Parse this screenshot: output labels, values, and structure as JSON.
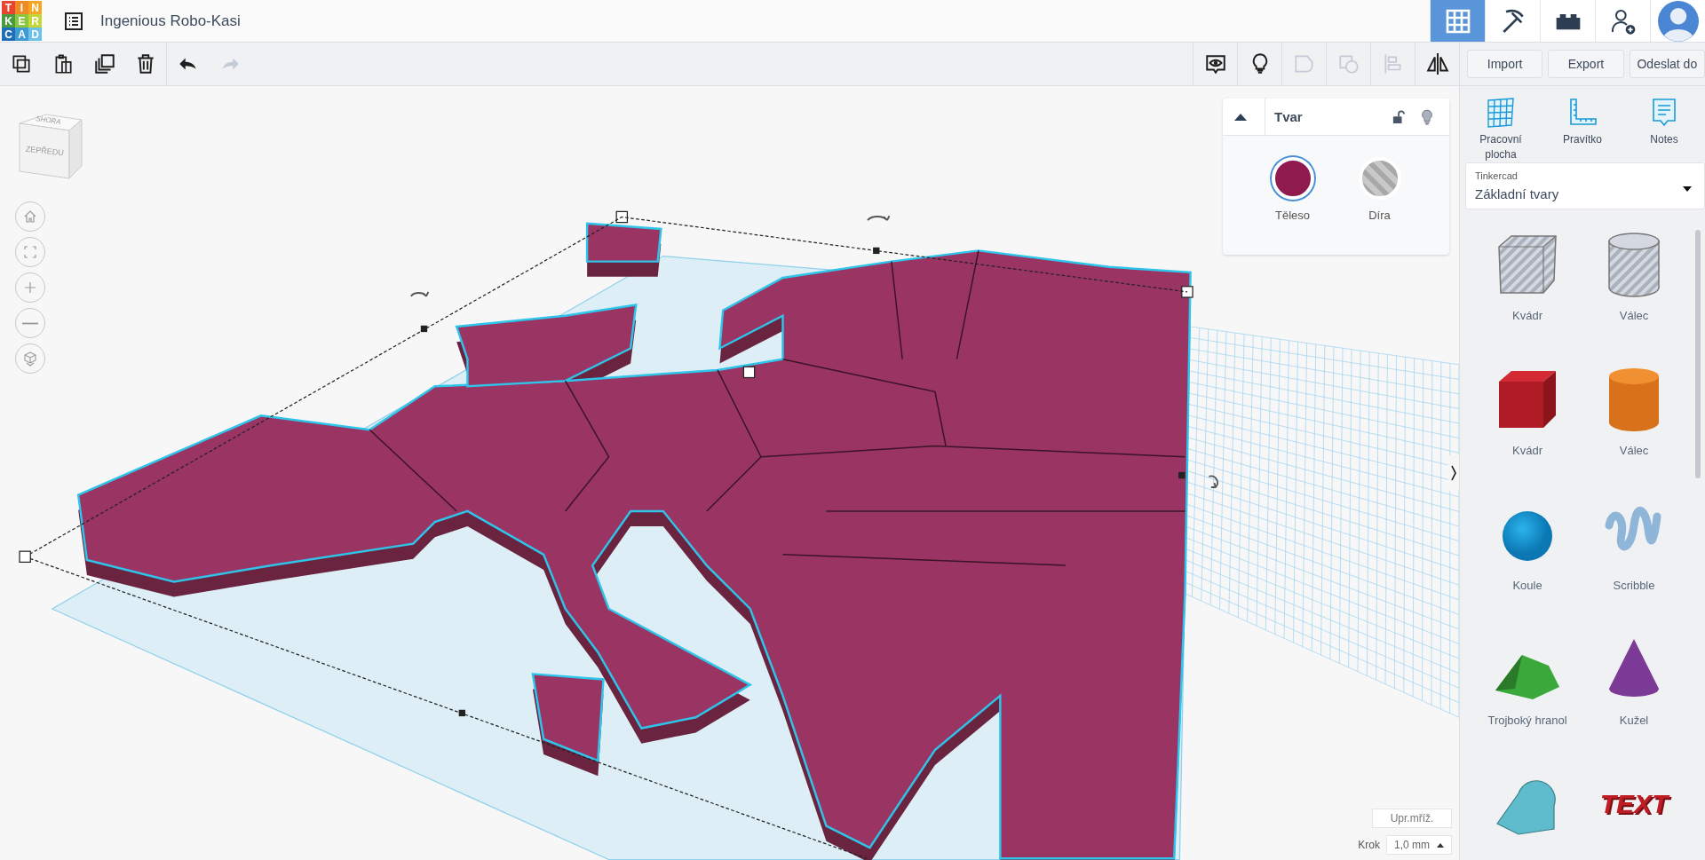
{
  "app": {
    "logo_letters": [
      "T",
      "I",
      "N",
      "K",
      "E",
      "R",
      "C",
      "A",
      "D"
    ],
    "title": "Ingenious Robo-Kasi"
  },
  "nav_tabs": [
    {
      "kind": "grid",
      "selected": true
    },
    {
      "kind": "pickaxe",
      "selected": false
    },
    {
      "kind": "bricks",
      "selected": false
    },
    {
      "kind": "add-user",
      "selected": false
    },
    {
      "kind": "avatar",
      "selected": false
    }
  ],
  "toolbar_left": [
    {
      "kind": "copy",
      "disabled": false
    },
    {
      "kind": "paste",
      "disabled": false
    },
    {
      "kind": "duplicate",
      "disabled": false
    },
    {
      "kind": "delete",
      "disabled": false
    },
    {
      "kind": "undo",
      "disabled": false
    },
    {
      "kind": "redo",
      "disabled": true
    }
  ],
  "toolbar_right": [
    {
      "kind": "notes-view",
      "disabled": false
    },
    {
      "kind": "bulb",
      "disabled": false
    },
    {
      "kind": "group",
      "disabled": true
    },
    {
      "kind": "ungroup",
      "disabled": true
    },
    {
      "kind": "align",
      "disabled": true
    },
    {
      "kind": "mirror",
      "disabled": false
    }
  ],
  "actions": [
    "Import",
    "Export",
    "Odeslat do"
  ],
  "view_cube": {
    "top": "SHORA",
    "front": "ZEPŘEDU"
  },
  "view_controls": [
    {
      "kind": "home"
    },
    {
      "kind": "fit"
    },
    {
      "kind": "zoom-in"
    },
    {
      "kind": "zoom-out"
    },
    {
      "kind": "perspective"
    }
  ],
  "shape_panel": {
    "title": "Tvar",
    "options": [
      {
        "kind": "solid",
        "label": "Těleso",
        "selected": true
      },
      {
        "kind": "hole",
        "label": "Díra",
        "selected": false
      }
    ]
  },
  "tools": [
    {
      "kind": "workplane",
      "label": "Pracovní plocha"
    },
    {
      "kind": "ruler",
      "label": "Pravítko"
    },
    {
      "kind": "notes",
      "label": "Notes"
    }
  ],
  "library": {
    "caption": "Tinkercad",
    "value": "Základní tvary"
  },
  "shapes": [
    {
      "kind": "box-hole",
      "label": "Kvádr"
    },
    {
      "kind": "cylinder-hole",
      "label": "Válec"
    },
    {
      "kind": "box",
      "label": "Kvádr"
    },
    {
      "kind": "cylinder",
      "label": "Válec"
    },
    {
      "kind": "sphere",
      "label": "Koule"
    },
    {
      "kind": "scribble",
      "label": "Scribble"
    },
    {
      "kind": "prism",
      "label": "Trojboký hranol"
    },
    {
      "kind": "cone",
      "label": "Kužel"
    },
    {
      "kind": "roof"
    },
    {
      "kind": "text",
      "thumb_text": "TEXT"
    }
  ],
  "grid": {
    "edit_label": "Upr.mříž.",
    "snap_label": "Krok",
    "snap_value": "1,0 mm"
  }
}
